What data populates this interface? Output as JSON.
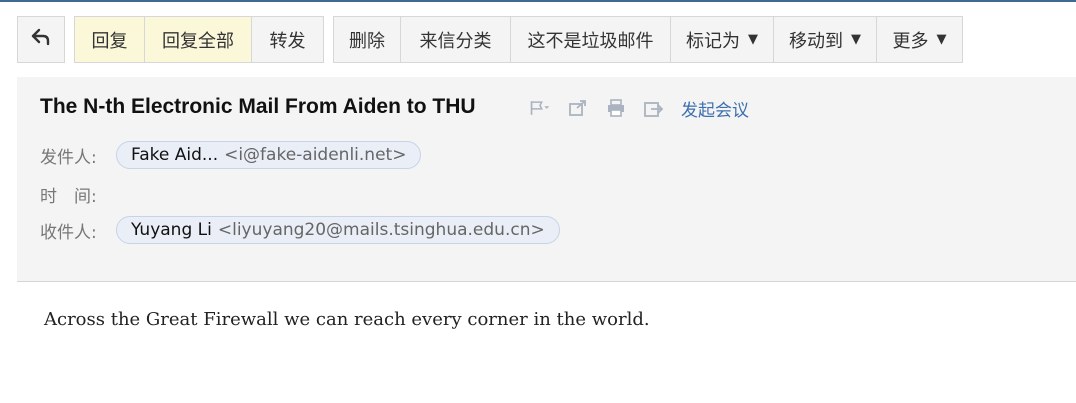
{
  "toolbar": {
    "back_icon": "reply-arrow-icon",
    "reply_label": "回复",
    "reply_all_label": "回复全部",
    "forward_label": "转发",
    "delete_label": "删除",
    "classify_label": "来信分类",
    "not_spam_label": "这不是垃圾邮件",
    "mark_as_label": "标记为",
    "move_to_label": "移动到",
    "more_label": "更多",
    "dropdown_glyph": "▼"
  },
  "mail": {
    "subject": "The N-th Electronic Mail From Aiden to THU",
    "meeting_label": "发起会议",
    "sender_label": "发件人:",
    "sender_name": "Fake Aid...",
    "sender_address": "<i@fake-aidenli.net>",
    "time_label": "时　间:",
    "recipient_label": "收件人:",
    "recipient_name": "Yuyang Li",
    "recipient_address": "<liyuyang20@mails.tsinghua.edu.cn>",
    "body": "Across the Great Firewall we can reach every corner in the world."
  },
  "icons": [
    "flag-icon",
    "share-icon",
    "print-icon",
    "export-icon"
  ],
  "colors": {
    "highlight_button": "#fbf8d9",
    "link": "#3d6fae",
    "chip_bg": "#e9eef7",
    "top_line": "#3e6a92"
  }
}
